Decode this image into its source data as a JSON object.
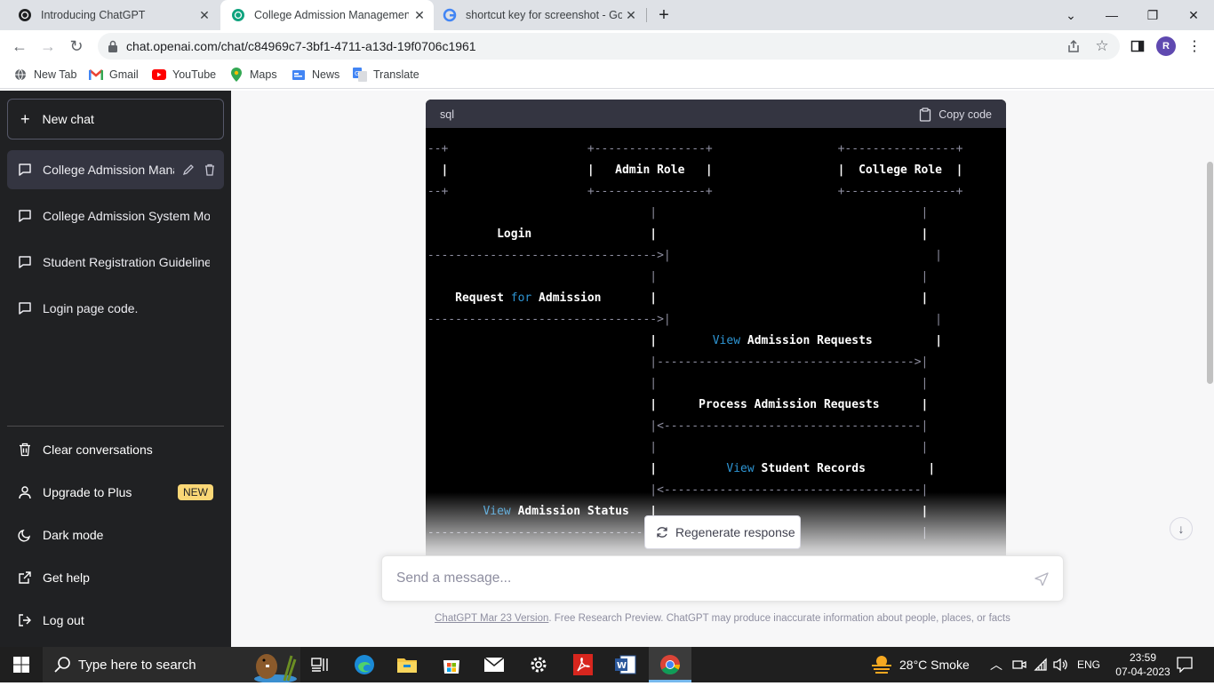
{
  "browser": {
    "tabs": [
      {
        "title": "Introducing ChatGPT",
        "active": false
      },
      {
        "title": "College Admission Management",
        "active": true
      },
      {
        "title": "shortcut key for screenshot - Goo",
        "active": false
      }
    ],
    "url": "chat.openai.com/chat/c84969c7-3bf1-4711-a13d-19f0706c1961",
    "profile_initial": "R",
    "bookmarks": [
      "New Tab",
      "Gmail",
      "YouTube",
      "Maps",
      "News",
      "Translate"
    ]
  },
  "sidebar": {
    "new_chat": "New chat",
    "chats": [
      "College Admission Management",
      "College Admission System Model",
      "Student Registration Guidelines",
      "Login page code."
    ],
    "options": {
      "clear": "Clear conversations",
      "upgrade": "Upgrade to Plus",
      "upgrade_badge": "NEW",
      "dark_mode": "Dark mode",
      "help": "Get help",
      "logout": "Log out"
    }
  },
  "code": {
    "language": "sql",
    "copy_label": "Copy code",
    "lines": [
      "---+                    +----------------+                  +----------------+",
      "   |                    |   Admin Role   |                  |  College Role  |",
      "---+                    +----------------+                  +----------------+",
      "                                 |                                      |",
      "           Login                 |                                      |",
      "---------------------------------->|                                      |",
      "                                 |                                      |",
      "     Request for Admission       |                                      |",
      "---------------------------------->|                                      |",
      "                                 |        View Admission Requests         |",
      "                                 |------------------------------------->|",
      "                                 |                                      |",
      "                                 |      Process Admission Requests      |",
      "                                 |<-------------------------------------|",
      "                                 |                                      |",
      "                                 |          View Student Records         |",
      "                                 |<-------------------------------------|",
      "         View Admission Status   |                                      |",
      "---------------------------------                                       |"
    ]
  },
  "regenerate_label": "Regenerate response",
  "message_placeholder": "Send a message...",
  "footer": {
    "version_link": "ChatGPT Mar 23 Version",
    "text": ". Free Research Preview. ChatGPT may produce inaccurate information about people, places, or facts"
  },
  "taskbar": {
    "search_placeholder": "Type here to search",
    "weather": "28°C  Smoke",
    "language": "ENG",
    "time": "23:59",
    "date": "07-04-2023"
  }
}
